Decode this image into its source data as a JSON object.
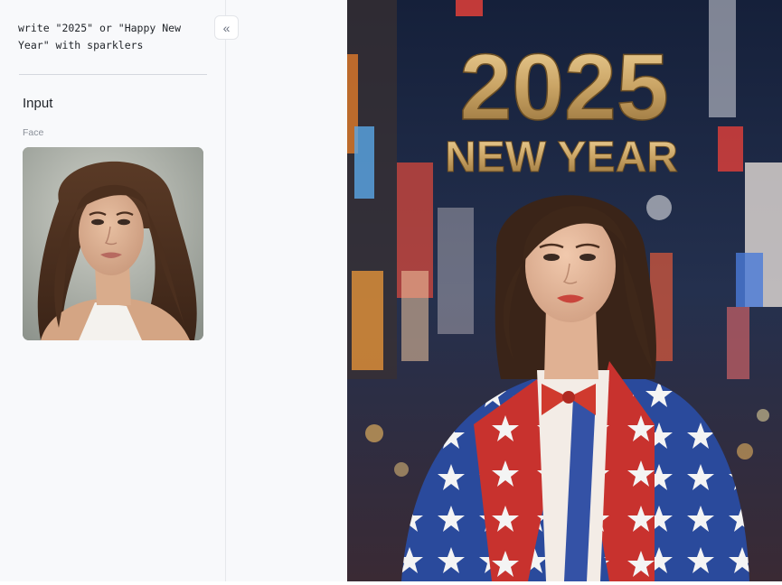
{
  "sidebar": {
    "prompt": "write \"2025\" or \"Happy New\nYear\" with sparklers",
    "section_title": "Input",
    "face_label": "Face",
    "collapse_icon": "double-chevron-left-icon"
  },
  "result": {
    "headline_year": "2025",
    "headline_text": "NEW YEAR"
  },
  "colors": {
    "sidebar_bg": "#f8f9fb",
    "gold": "#c9a364",
    "jacket_red": "#c8322e",
    "jacket_blue": "#2a4a9c"
  }
}
